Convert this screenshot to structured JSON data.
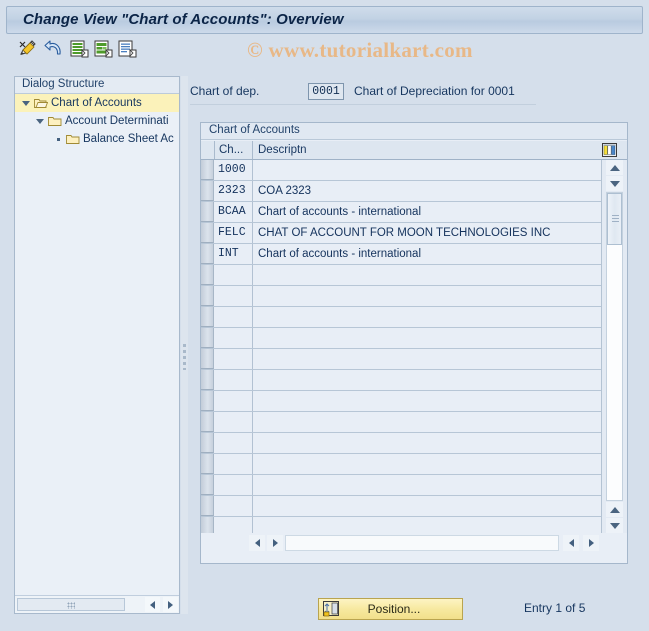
{
  "window": {
    "title": "Change View \"Chart of Accounts\": Overview"
  },
  "watermark": {
    "text": "© www.tutorialkart.com",
    "color": "#e8b887"
  },
  "toolbar": {
    "buttons": [
      {
        "name": "change-display-icon",
        "tooltip": "Display -> Change"
      },
      {
        "name": "undo-icon",
        "tooltip": "Undo"
      },
      {
        "name": "new-entries-icon",
        "tooltip": "New Entries"
      },
      {
        "name": "copy-as-icon",
        "tooltip": "Copy As..."
      },
      {
        "name": "details-icon",
        "tooltip": "Details"
      }
    ]
  },
  "sidebar": {
    "header": "Dialog Structure",
    "items": [
      {
        "label": "Chart of Accounts",
        "icon": "folder-open-icon",
        "selected": true,
        "level": 0,
        "expander": "triangle-down"
      },
      {
        "label": "Account Determinati",
        "icon": "folder-icon",
        "selected": false,
        "level": 1,
        "expander": "triangle-down"
      },
      {
        "label": "Balance Sheet Ac",
        "icon": "folder-icon",
        "selected": false,
        "level": 2,
        "expander": "bullet"
      }
    ]
  },
  "main": {
    "chart_of_dep": {
      "label": "Chart of dep.",
      "value": "0001",
      "description": "Chart of Depreciation for 0001"
    },
    "table": {
      "title": "Chart of Accounts",
      "columns": [
        {
          "key": "chart",
          "label": "Ch..."
        },
        {
          "key": "descriptn",
          "label": "Descriptn"
        }
      ],
      "settings_icon": "table-settings-icon",
      "rows": [
        {
          "chart": "1000",
          "descriptn": ""
        },
        {
          "chart": "2323",
          "descriptn": "COA 2323"
        },
        {
          "chart": "BCAA",
          "descriptn": "Chart of accounts - international"
        },
        {
          "chart": "FELC",
          "descriptn": "CHAT OF ACCOUNT FOR MOON TECHNOLOGIES INC"
        },
        {
          "chart": "INT",
          "descriptn": "Chart of accounts - international"
        },
        {
          "chart": "",
          "descriptn": ""
        },
        {
          "chart": "",
          "descriptn": ""
        },
        {
          "chart": "",
          "descriptn": ""
        },
        {
          "chart": "",
          "descriptn": ""
        },
        {
          "chart": "",
          "descriptn": ""
        },
        {
          "chart": "",
          "descriptn": ""
        },
        {
          "chart": "",
          "descriptn": ""
        },
        {
          "chart": "",
          "descriptn": ""
        },
        {
          "chart": "",
          "descriptn": ""
        },
        {
          "chart": "",
          "descriptn": ""
        },
        {
          "chart": "",
          "descriptn": ""
        },
        {
          "chart": "",
          "descriptn": ""
        },
        {
          "chart": "",
          "descriptn": ""
        }
      ]
    }
  },
  "footer": {
    "position_button": {
      "label": "Position...",
      "icon": "position-icon"
    },
    "entry_status": "Entry 1 of 5"
  }
}
